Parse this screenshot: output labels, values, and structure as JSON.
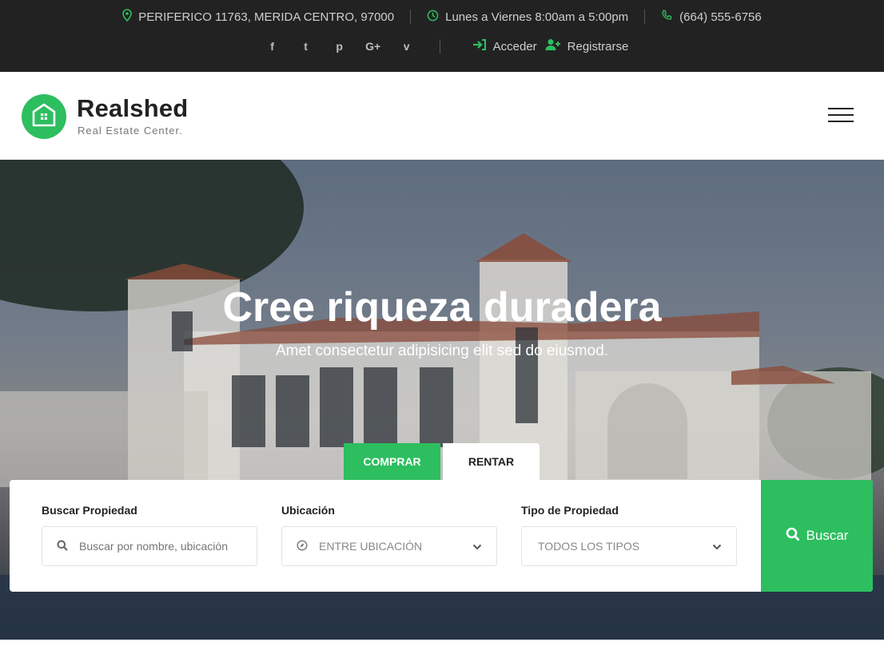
{
  "topbar": {
    "address": "PERIFERICO 11763, MERIDA CENTRO, 97000",
    "hours": "Lunes a Viernes 8:00am a 5:00pm",
    "phone": "(664) 555-6756",
    "social": [
      "f",
      "t",
      "p",
      "G+",
      "v"
    ],
    "login_label": "Acceder",
    "register_label": "Registrarse"
  },
  "header": {
    "brand": "Realshed",
    "tagline": "Real Estate Center."
  },
  "hero": {
    "title": "Cree riqueza duradera",
    "subtitle": "Amet consectetur adipisicing elit sed do eiusmod."
  },
  "tabs": {
    "buy": "COMPRAR",
    "rent": "RENTAR"
  },
  "search": {
    "property_label": "Buscar Propiedad",
    "property_placeholder": "Buscar por nombre, ubicación",
    "location_label": "Ubicación",
    "location_value": "ENTRE UBICACIÓN",
    "type_label": "Tipo de Propiedad",
    "type_value": "TODOS LOS TIPOS",
    "button_label": "Buscar"
  },
  "colors": {
    "accent": "#2dbe60",
    "topbar_bg": "#222222"
  }
}
